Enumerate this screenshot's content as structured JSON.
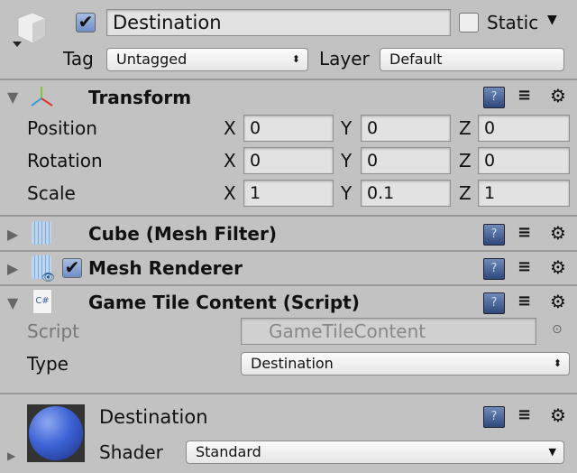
{
  "header": {
    "active": true,
    "name": "Destination",
    "static_label": "Static",
    "static": false,
    "tag_label": "Tag",
    "tag": "Untagged",
    "layer_label": "Layer",
    "layer": "Default"
  },
  "transform": {
    "title": "Transform",
    "rows": [
      {
        "label": "Position",
        "x": "0",
        "y": "0",
        "z": "0"
      },
      {
        "label": "Rotation",
        "x": "0",
        "y": "0",
        "z": "0"
      },
      {
        "label": "Scale",
        "x": "1",
        "y": "0.1",
        "z": "1"
      }
    ],
    "axes": {
      "x": "X",
      "y": "Y",
      "z": "Z"
    }
  },
  "mesh_filter": {
    "title": "Cube (Mesh Filter)"
  },
  "mesh_renderer": {
    "title": "Mesh Renderer",
    "enabled": true
  },
  "script_component": {
    "title": "Game Tile Content (Script)",
    "script_label": "Script",
    "script_value": "GameTileContent",
    "type_label": "Type",
    "type_value": "Destination",
    "cs_badge": "C#"
  },
  "material": {
    "name": "Destination",
    "shader_label": "Shader",
    "shader": "Standard",
    "sphere_color": "#3d63d6"
  }
}
